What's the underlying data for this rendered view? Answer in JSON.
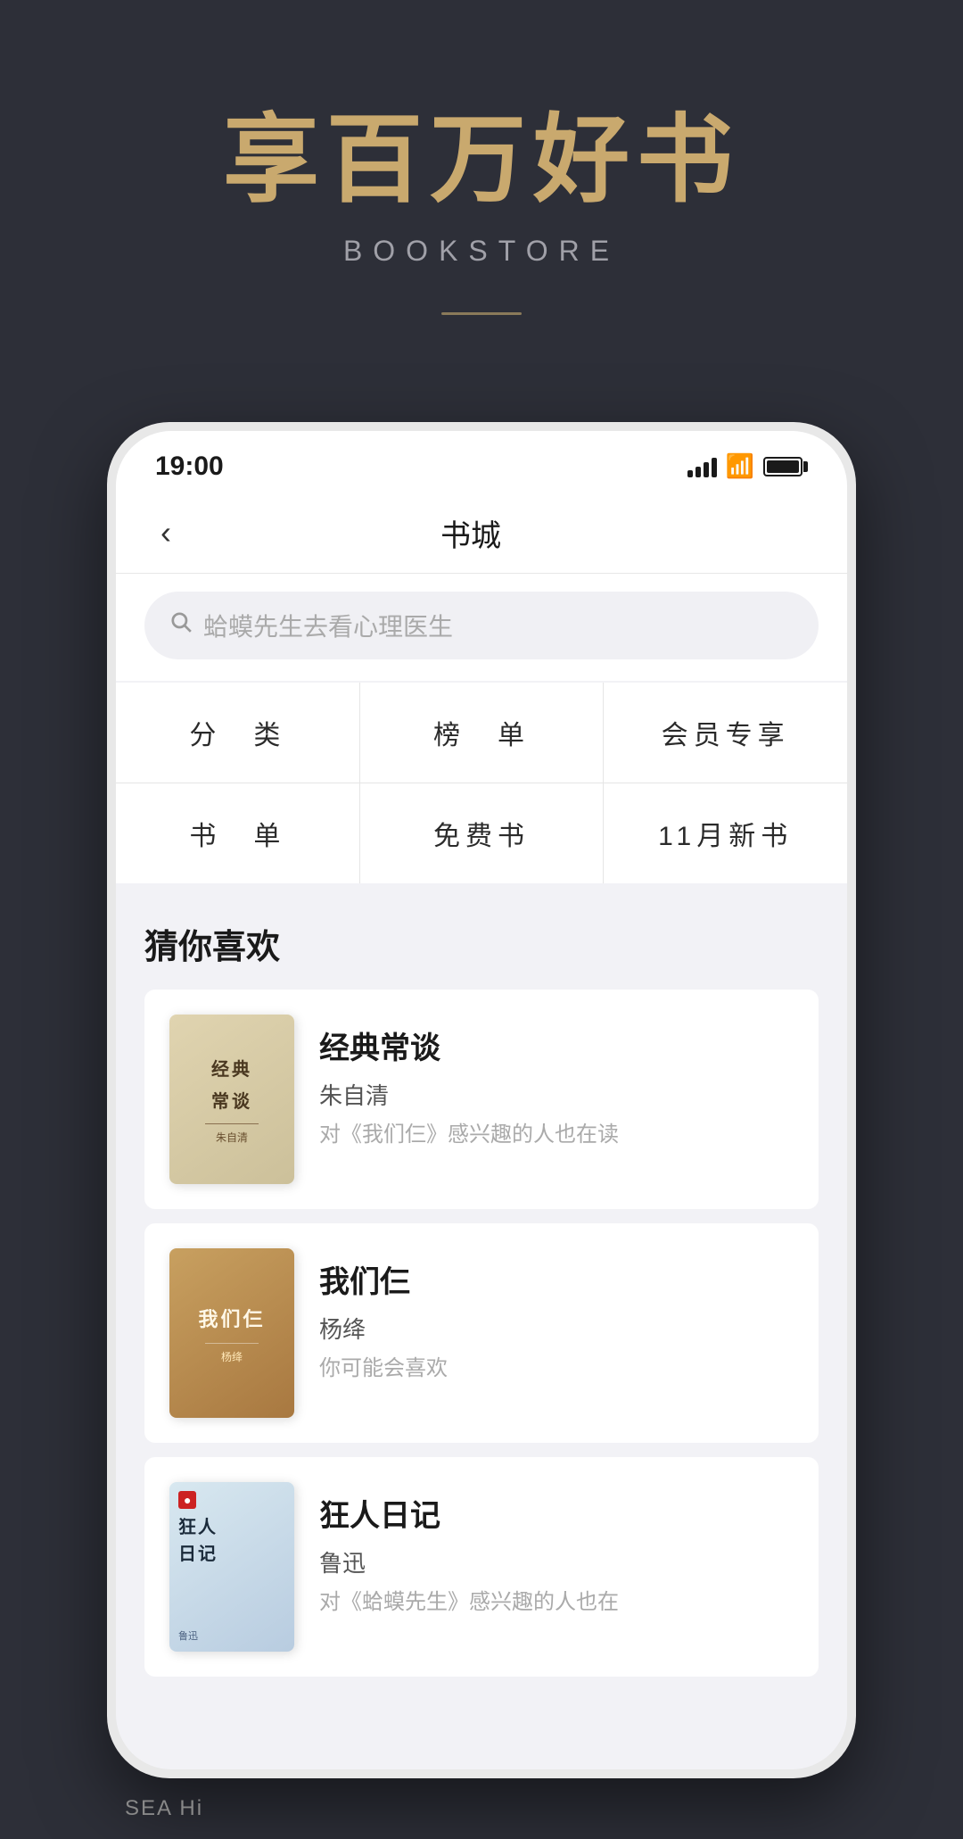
{
  "page": {
    "background_color": "#2d2f38",
    "main_title": "享百万好书",
    "subtitle": "BOOKSTORE",
    "status_bar": {
      "time": "19:00"
    },
    "nav": {
      "title": "书城",
      "back_label": "‹"
    },
    "search": {
      "placeholder": "蛤蟆先生去看心理医生"
    },
    "categories": [
      {
        "label": "分　类"
      },
      {
        "label": "榜　单"
      },
      {
        "label": "会员专享"
      },
      {
        "label": "书　单"
      },
      {
        "label": "免费书"
      },
      {
        "label": "11月新书"
      }
    ],
    "recommend_section": {
      "title": "猜你喜欢",
      "books": [
        {
          "name": "经典常谈",
          "author": "朱自清",
          "desc": "对《我们仨》感兴趣的人也在读",
          "cover_text": "经典\n常谈",
          "cover_type": "1"
        },
        {
          "name": "我们仨",
          "author": "杨绛",
          "desc": "你可能会喜欢",
          "cover_text": "我们仨",
          "cover_type": "2"
        },
        {
          "name": "狂人日记",
          "author": "鲁迅",
          "desc": "对《蛤蟆先生》感兴趣的人也在",
          "cover_text": "狂人日记",
          "cover_type": "3"
        }
      ]
    },
    "bottom": {
      "sea_hi": "SEA Hi"
    }
  }
}
